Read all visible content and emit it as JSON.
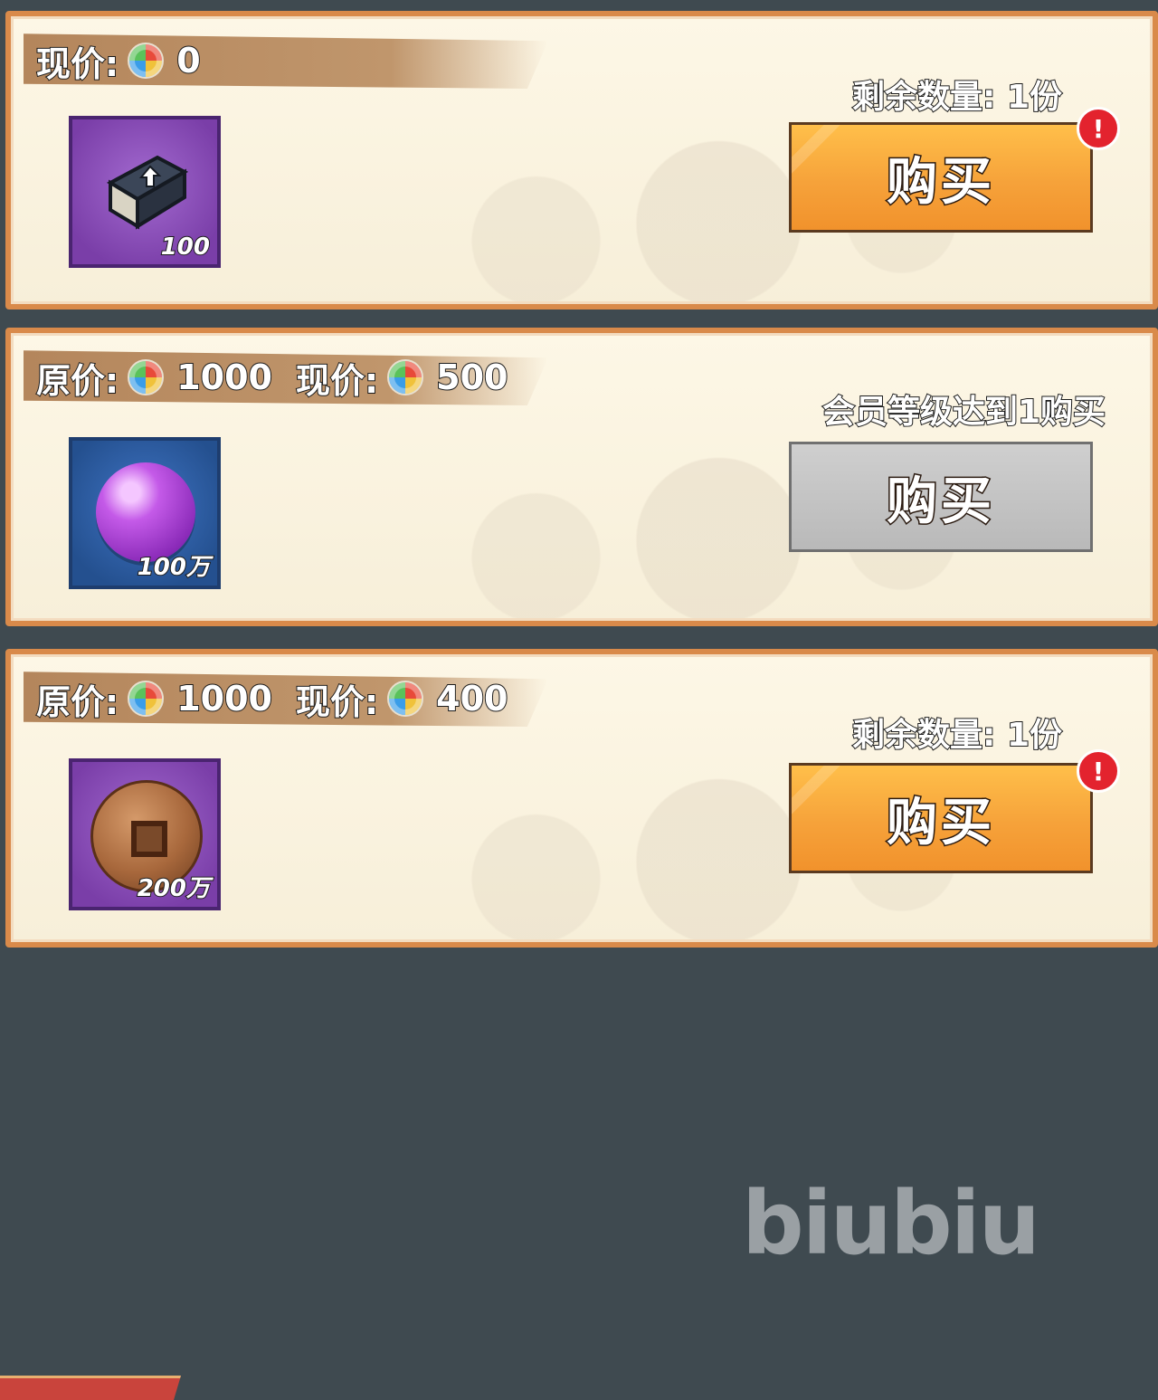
{
  "items": [
    {
      "price_text": "现价:",
      "current_price": "0",
      "qty": "100",
      "item": "exp-book-icon",
      "frame": "purple",
      "status": "剩余数量: 1份",
      "buy_label": "购买",
      "buy_enabled": true,
      "alert": "!"
    },
    {
      "original_text": "原价:",
      "original_price": "1000",
      "price_text": "现价:",
      "current_price": "500",
      "qty": "100万",
      "item": "purple-orb-icon",
      "frame": "blue",
      "status": "会员等级达到1购买",
      "buy_label": "购买",
      "buy_enabled": false
    },
    {
      "original_text": "原价:",
      "original_price": "1000",
      "price_text": "现价:",
      "current_price": "400",
      "qty": "200万",
      "item": "copper-coin-icon",
      "frame": "purple",
      "status": "剩余数量: 1份",
      "buy_label": "购买",
      "buy_enabled": true,
      "alert": "!"
    }
  ],
  "watermark": "biubiu",
  "colors": {
    "card_border": "#d98a4a",
    "buy_orange": "#f6a23a",
    "buy_disabled": "#b9b9b9",
    "alert_red": "#e3232e",
    "background": "#3f4a50"
  }
}
